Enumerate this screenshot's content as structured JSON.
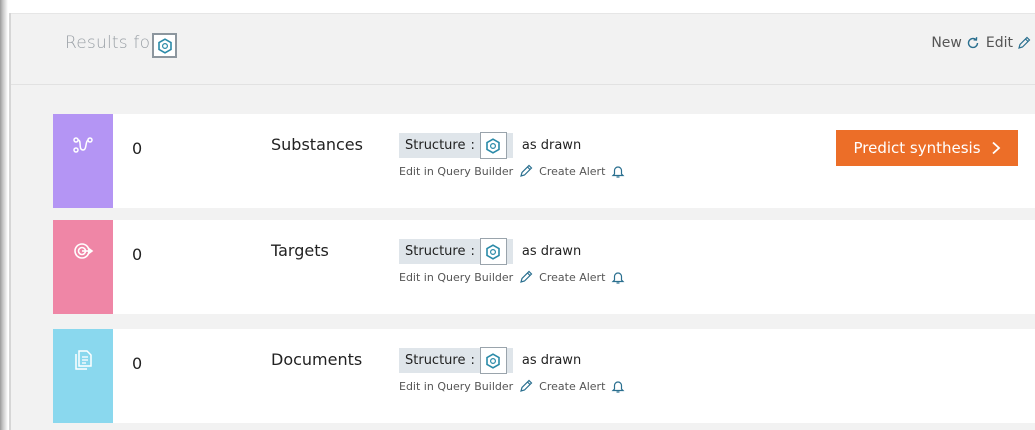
{
  "header": {
    "results_for": "Results for",
    "new_label": "New",
    "edit_label": "Edit"
  },
  "results": [
    {
      "count": "0",
      "category": "Substances",
      "structure_label": "Structure",
      "separator": ":",
      "as_drawn": "as drawn",
      "edit_in_query_builder": "Edit in Query Builder",
      "create_alert": "Create Alert",
      "color": "#b495f4",
      "icon": "reaction-path-icon",
      "action_label": "Predict synthesis"
    },
    {
      "count": "0",
      "category": "Targets",
      "structure_label": "Structure",
      "separator": ":",
      "as_drawn": "as drawn",
      "edit_in_query_builder": "Edit in Query Builder",
      "create_alert": "Create Alert",
      "color": "#ef86a6",
      "icon": "target-icon"
    },
    {
      "count": "0",
      "category": "Documents",
      "structure_label": "Structure",
      "separator": ":",
      "as_drawn": "as drawn",
      "edit_in_query_builder": "Edit in Query Builder",
      "create_alert": "Create Alert",
      "color": "#8ad8ee",
      "icon": "documents-icon"
    }
  ],
  "colors": {
    "accent_orange": "#ec6e28",
    "link_blue": "#2a6f8f",
    "pill_bg": "#dfe5ea"
  }
}
